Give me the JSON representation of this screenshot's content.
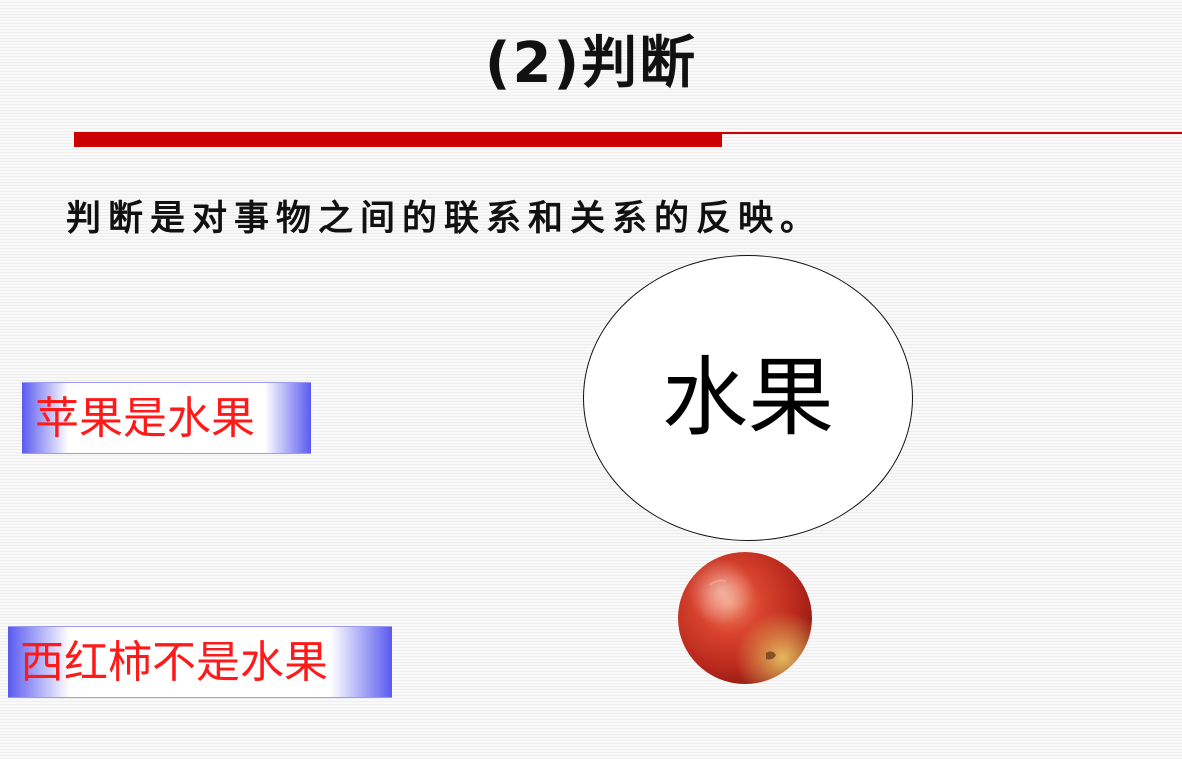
{
  "slide": {
    "title": "(2)判断",
    "definition": "判断是对事物之间的联系和关系的反映。"
  },
  "examples": {
    "apple_statement": "苹果是水果",
    "tomato_statement": "西红柿不是水果"
  },
  "diagram": {
    "set_label": "水果",
    "image_subject": "apple-icon"
  },
  "colors": {
    "accent_rule": "#cc0000",
    "statement_text": "#ff1a1a",
    "box_gradient_edge": "#5a5af0"
  }
}
